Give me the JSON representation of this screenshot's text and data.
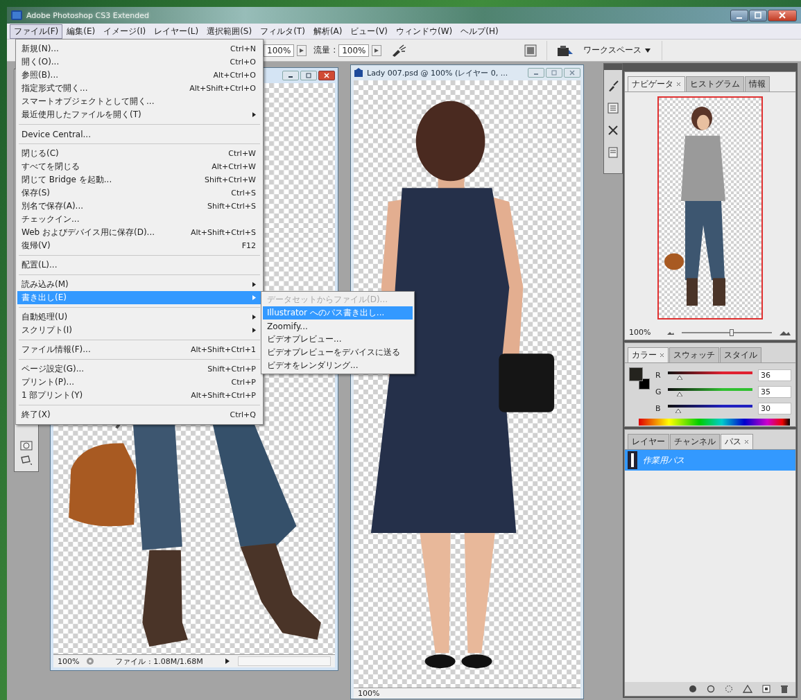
{
  "window": {
    "title": "Adobe Photoshop CS3 Extended"
  },
  "menubar": [
    {
      "label": "ファイル(F)",
      "selected": true
    },
    {
      "label": "編集(E)",
      "selected": false
    },
    {
      "label": "イメージ(I)",
      "selected": false
    },
    {
      "label": "レイヤー(L)",
      "selected": false
    },
    {
      "label": "選択範囲(S)",
      "selected": false
    },
    {
      "label": "フィルタ(T)",
      "selected": false
    },
    {
      "label": "解析(A)",
      "selected": false
    },
    {
      "label": "ビュー(V)",
      "selected": false
    },
    {
      "label": "ウィンドウ(W)",
      "selected": false
    },
    {
      "label": "ヘルプ(H)",
      "selected": false
    }
  ],
  "options_bar": {
    "opacity_value": "100%",
    "flow_label": "流量 :",
    "flow_value": "100%",
    "workspace": "ワークスペース"
  },
  "file_menu": [
    {
      "kind": "item",
      "label": "新規(N)...",
      "shortcut": "Ctrl+N",
      "submenu": false,
      "selected": false
    },
    {
      "kind": "item",
      "label": "開く(O)...",
      "shortcut": "Ctrl+O",
      "submenu": false,
      "selected": false
    },
    {
      "kind": "item",
      "label": "参照(B)...",
      "shortcut": "Alt+Ctrl+O",
      "submenu": false,
      "selected": false
    },
    {
      "kind": "item",
      "label": "指定形式で開く...",
      "shortcut": "Alt+Shift+Ctrl+O",
      "submenu": false,
      "selected": false
    },
    {
      "kind": "item",
      "label": "スマートオブジェクトとして開く...",
      "submenu": false,
      "selected": false
    },
    {
      "kind": "item",
      "label": "最近使用したファイルを開く(T)",
      "submenu": true,
      "selected": false
    },
    {
      "kind": "separator"
    },
    {
      "kind": "item",
      "label": "Device Central...",
      "submenu": false,
      "selected": false
    },
    {
      "kind": "separator"
    },
    {
      "kind": "item",
      "label": "閉じる(C)",
      "shortcut": "Ctrl+W",
      "submenu": false,
      "selected": false
    },
    {
      "kind": "item",
      "label": "すべてを閉じる",
      "shortcut": "Alt+Ctrl+W",
      "submenu": false,
      "selected": false
    },
    {
      "kind": "item",
      "label": "閉じて Bridge を起動...",
      "shortcut": "Shift+Ctrl+W",
      "submenu": false,
      "selected": false
    },
    {
      "kind": "item",
      "label": "保存(S)",
      "shortcut": "Ctrl+S",
      "submenu": false,
      "selected": false
    },
    {
      "kind": "item",
      "label": "別名で保存(A)...",
      "shortcut": "Shift+Ctrl+S",
      "submenu": false,
      "selected": false
    },
    {
      "kind": "item",
      "label": "チェックイン...",
      "submenu": false,
      "selected": false
    },
    {
      "kind": "item",
      "label": "Web およびデバイス用に保存(D)...",
      "shortcut": "Alt+Shift+Ctrl+S",
      "submenu": false,
      "selected": false
    },
    {
      "kind": "item",
      "label": "復帰(V)",
      "shortcut": "F12",
      "submenu": false,
      "selected": false
    },
    {
      "kind": "separator"
    },
    {
      "kind": "item",
      "label": "配置(L)...",
      "submenu": false,
      "selected": false
    },
    {
      "kind": "separator"
    },
    {
      "kind": "item",
      "label": "読み込み(M)",
      "submenu": true,
      "selected": false
    },
    {
      "kind": "item",
      "label": "書き出し(E)",
      "submenu": true,
      "selected": true
    },
    {
      "kind": "separator"
    },
    {
      "kind": "item",
      "label": "自動処理(U)",
      "submenu": true,
      "selected": false
    },
    {
      "kind": "item",
      "label": "スクリプト(I)",
      "submenu": true,
      "selected": false
    },
    {
      "kind": "separator"
    },
    {
      "kind": "item",
      "label": "ファイル情報(F)...",
      "shortcut": "Alt+Shift+Ctrl+1",
      "submenu": false,
      "selected": false
    },
    {
      "kind": "separator"
    },
    {
      "kind": "item",
      "label": "ページ設定(G)...",
      "shortcut": "Shift+Ctrl+P",
      "submenu": false,
      "selected": false
    },
    {
      "kind": "item",
      "label": "プリント(P)...",
      "shortcut": "Ctrl+P",
      "submenu": false,
      "selected": false
    },
    {
      "kind": "item",
      "label": "1 部プリント(Y)",
      "shortcut": "Alt+Shift+Ctrl+P",
      "submenu": false,
      "selected": false
    },
    {
      "kind": "separator"
    },
    {
      "kind": "item",
      "label": "終了(X)",
      "shortcut": "Ctrl+Q",
      "submenu": false,
      "selected": false
    }
  ],
  "export_submenu": [
    {
      "label": "データセットからファイル(D)...",
      "disabled": true,
      "selected": false
    },
    {
      "label": "Illustrator へのパス書き出し...",
      "disabled": false,
      "selected": true
    },
    {
      "label": "Zoomify...",
      "disabled": false,
      "selected": false
    },
    {
      "label": "ビデオプレビュー...",
      "disabled": false,
      "selected": false
    },
    {
      "label": "ビデオプレビューをデバイスに送る",
      "disabled": false,
      "selected": false
    },
    {
      "label": "ビデオをレンダリング...",
      "disabled": false,
      "selected": false
    }
  ],
  "document_left": {
    "zoom": "100%",
    "file_info": "ファイル : 1.08M/1.68M"
  },
  "document_right": {
    "title": "Lady 007.psd @ 100% (レイヤー 0, ...",
    "zoom": "100%"
  },
  "panels": {
    "navigator": {
      "tabs": [
        {
          "label": "ナビゲータ",
          "selected": true
        },
        {
          "label": "ヒストグラム",
          "selected": false
        },
        {
          "label": "情報",
          "selected": false
        }
      ],
      "zoom": "100%",
      "level": 0.55
    },
    "color": {
      "tabs": [
        {
          "label": "カラー",
          "selected": true
        },
        {
          "label": "スウォッチ",
          "selected": false
        },
        {
          "label": "スタイル",
          "selected": false
        }
      ],
      "channels": [
        {
          "name": "R",
          "value": "36",
          "level": 0.14,
          "color": "#e02030"
        },
        {
          "name": "G",
          "value": "35",
          "level": 0.14,
          "color": "#30c030"
        },
        {
          "name": "B",
          "value": "30",
          "level": 0.12,
          "color": "#2020c0"
        }
      ]
    },
    "paths": {
      "tabs": [
        {
          "label": "レイヤー",
          "selected": false
        },
        {
          "label": "チャンネル",
          "selected": false
        },
        {
          "label": "パス",
          "selected": true
        }
      ],
      "items": [
        {
          "label": "作業用パス",
          "selected": true
        }
      ]
    }
  }
}
